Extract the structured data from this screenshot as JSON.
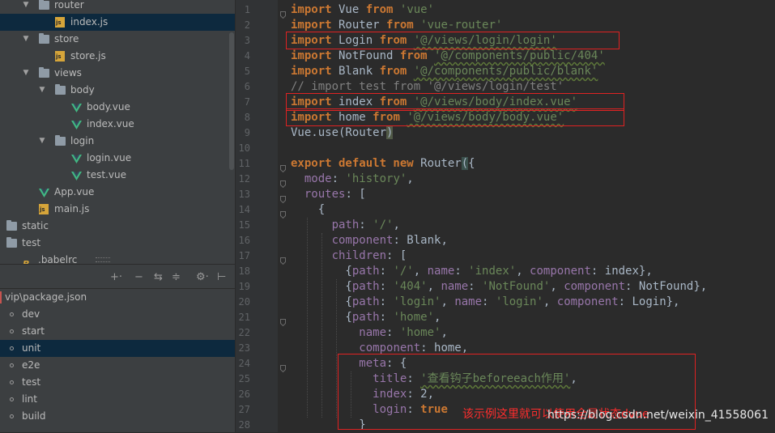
{
  "project_tree": {
    "items": [
      {
        "label": "router",
        "type": "folder",
        "depth": 1,
        "expanded": true
      },
      {
        "label": "index.js",
        "type": "js",
        "depth": 2,
        "selected": true
      },
      {
        "label": "store",
        "type": "folder",
        "depth": 1,
        "expanded": true
      },
      {
        "label": "store.js",
        "type": "js",
        "depth": 2
      },
      {
        "label": "views",
        "type": "folder",
        "depth": 1,
        "expanded": true
      },
      {
        "label": "body",
        "type": "folder",
        "depth": 2,
        "expanded": true
      },
      {
        "label": "body.vue",
        "type": "vue",
        "depth": 3
      },
      {
        "label": "index.vue",
        "type": "vue",
        "depth": 3
      },
      {
        "label": "login",
        "type": "folder",
        "depth": 2,
        "expanded": true
      },
      {
        "label": "login.vue",
        "type": "vue",
        "depth": 3
      },
      {
        "label": "test.vue",
        "type": "vue",
        "depth": 3
      },
      {
        "label": "App.vue",
        "type": "vue",
        "depth": 1
      },
      {
        "label": "main.js",
        "type": "js",
        "depth": 1
      },
      {
        "label": "static",
        "type": "folder",
        "depth": 0
      },
      {
        "label": "test",
        "type": "folder",
        "depth": 0
      },
      {
        "label": ".babelrc",
        "type": "babel",
        "depth": 0
      }
    ]
  },
  "npm_panel": {
    "toolbar": [
      "+·",
      "−",
      "⇆",
      "≑",
      "⚙·",
      "⊢"
    ],
    "title": "vip\\package.json",
    "scripts": [
      "dev",
      "start",
      "unit",
      "e2e",
      "test",
      "lint",
      "build"
    ],
    "selected_script": "unit"
  },
  "editor": {
    "line_numbers": [
      "1",
      "2",
      "3",
      "4",
      "5",
      "6",
      "7",
      "8",
      "9",
      "10",
      "11",
      "12",
      "13",
      "14",
      "15",
      "16",
      "17",
      "18",
      "19",
      "20",
      "21",
      "22",
      "23",
      "24",
      "25",
      "26",
      "27",
      "28"
    ],
    "highlighted_lines": [
      3,
      7,
      8
    ],
    "lines": [
      [
        [
          "kw",
          "import"
        ],
        [
          "p",
          " Vue "
        ],
        [
          "kw",
          "from"
        ],
        [
          "p",
          " "
        ],
        [
          "str",
          "'vue'"
        ]
      ],
      [
        [
          "kw",
          "import"
        ],
        [
          "p",
          " Router "
        ],
        [
          "kw",
          "from"
        ],
        [
          "p",
          " "
        ],
        [
          "str",
          "'vue-router'"
        ]
      ],
      [
        [
          "kw",
          "import"
        ],
        [
          "p",
          " Login "
        ],
        [
          "kw",
          "from"
        ],
        [
          "p",
          " "
        ],
        [
          "strw",
          "'@/views/login/login'"
        ]
      ],
      [
        [
          "kw",
          "import"
        ],
        [
          "p",
          " NotFound "
        ],
        [
          "kw",
          "from"
        ],
        [
          "p",
          " "
        ],
        [
          "strw",
          "'@/components/public/404'"
        ]
      ],
      [
        [
          "kw",
          "import"
        ],
        [
          "p",
          " Blank "
        ],
        [
          "kw",
          "from"
        ],
        [
          "p",
          " "
        ],
        [
          "strw",
          "'@/components/public/blank'"
        ]
      ],
      [
        [
          "cmt",
          "// import test from '@/views/login/test'"
        ]
      ],
      [
        [
          "kw",
          "import"
        ],
        [
          "p",
          " index "
        ],
        [
          "kw",
          "from"
        ],
        [
          "p",
          " "
        ],
        [
          "strw",
          "'@/views/body/index.vue'"
        ]
      ],
      [
        [
          "kw",
          "import"
        ],
        [
          "p",
          " home "
        ],
        [
          "kw",
          "from"
        ],
        [
          "p",
          " "
        ],
        [
          "strw",
          "'@/views/body/body.vue'"
        ]
      ],
      [
        [
          "p",
          "Vue.use(Router"
        ],
        [
          "caret",
          ")"
        ]
      ],
      [
        [
          "p",
          ""
        ]
      ],
      [
        [
          "kw",
          "export default new"
        ],
        [
          "p",
          " Router"
        ],
        [
          "brk",
          "("
        ],
        [
          "p",
          "{"
        ]
      ],
      [
        [
          "p",
          "  "
        ],
        [
          "prop",
          "mode"
        ],
        [
          "p",
          ": "
        ],
        [
          "str",
          "'history'"
        ],
        [
          "p",
          ","
        ]
      ],
      [
        [
          "p",
          "  "
        ],
        [
          "prop",
          "routes"
        ],
        [
          "p",
          ": ["
        ]
      ],
      [
        [
          "p",
          "    {"
        ]
      ],
      [
        [
          "p",
          "      "
        ],
        [
          "prop",
          "path"
        ],
        [
          "p",
          ": "
        ],
        [
          "str",
          "'/'"
        ],
        [
          "p",
          ","
        ]
      ],
      [
        [
          "p",
          "      "
        ],
        [
          "prop",
          "component"
        ],
        [
          "p",
          ": Blank,"
        ]
      ],
      [
        [
          "p",
          "      "
        ],
        [
          "prop",
          "children"
        ],
        [
          "p",
          ": ["
        ]
      ],
      [
        [
          "p",
          "        {"
        ],
        [
          "prop",
          "path"
        ],
        [
          "p",
          ": "
        ],
        [
          "str",
          "'/'"
        ],
        [
          "p",
          ", "
        ],
        [
          "prop",
          "name"
        ],
        [
          "p",
          ": "
        ],
        [
          "str",
          "'index'"
        ],
        [
          "p",
          ", "
        ],
        [
          "prop",
          "component"
        ],
        [
          "p",
          ": index},"
        ]
      ],
      [
        [
          "p",
          "        {"
        ],
        [
          "prop",
          "path"
        ],
        [
          "p",
          ": "
        ],
        [
          "str",
          "'404'"
        ],
        [
          "p",
          ", "
        ],
        [
          "prop",
          "name"
        ],
        [
          "p",
          ": "
        ],
        [
          "str",
          "'NotFound'"
        ],
        [
          "p",
          ", "
        ],
        [
          "prop",
          "component"
        ],
        [
          "p",
          ": NotFound},"
        ]
      ],
      [
        [
          "p",
          "        {"
        ],
        [
          "prop",
          "path"
        ],
        [
          "p",
          ": "
        ],
        [
          "str",
          "'login'"
        ],
        [
          "p",
          ", "
        ],
        [
          "prop",
          "name"
        ],
        [
          "p",
          ": "
        ],
        [
          "str",
          "'login'"
        ],
        [
          "p",
          ", "
        ],
        [
          "prop",
          "component"
        ],
        [
          "p",
          ": Login},"
        ]
      ],
      [
        [
          "p",
          "        {"
        ],
        [
          "prop",
          "path"
        ],
        [
          "p",
          ": "
        ],
        [
          "str",
          "'home'"
        ],
        [
          "p",
          ","
        ]
      ],
      [
        [
          "p",
          "          "
        ],
        [
          "prop",
          "name"
        ],
        [
          "p",
          ": "
        ],
        [
          "str",
          "'home'"
        ],
        [
          "p",
          ","
        ]
      ],
      [
        [
          "p",
          "          "
        ],
        [
          "prop",
          "component"
        ],
        [
          "p",
          ": home,"
        ]
      ],
      [
        [
          "p",
          "          "
        ],
        [
          "prop",
          "meta"
        ],
        [
          "p",
          ": {"
        ]
      ],
      [
        [
          "p",
          "            "
        ],
        [
          "prop",
          "title"
        ],
        [
          "p",
          ": "
        ],
        [
          "strw",
          "'查看钩子beforeeach作用'"
        ],
        [
          "p",
          ","
        ]
      ],
      [
        [
          "p",
          "            "
        ],
        [
          "prop",
          "index"
        ],
        [
          "p",
          ": 2,"
        ]
      ],
      [
        [
          "p",
          "            "
        ],
        [
          "prop",
          "login"
        ],
        [
          "p",
          ": "
        ],
        [
          "kw",
          "true"
        ]
      ],
      [
        [
          "p",
          "          }"
        ]
      ]
    ]
  },
  "annotation": "该示例这里就可以使用全局状态dvue",
  "watermark": "https://blog.csdn.net/weixin_41558061",
  "colors": {
    "keyword": "#cc7832",
    "string": "#6a8759",
    "property": "#9876aa",
    "comment": "#808080",
    "highlight_box": "#e02222"
  }
}
